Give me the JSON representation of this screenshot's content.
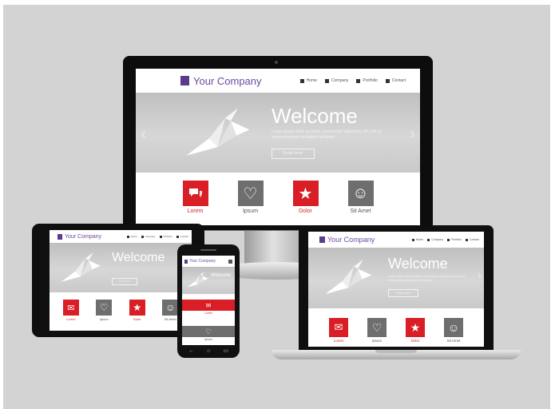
{
  "site": {
    "brand": "Your Company",
    "nav": [
      "Home",
      "Company",
      "Portfolio",
      "Contact"
    ],
    "hero": {
      "title": "Welcome",
      "tagline": "Lorem ipsum dolor sit amet, consectetur adipiscing elit, sed do eiusmod tempor incididunt ut labore",
      "cta": "Read more"
    },
    "features": [
      {
        "label": "Lorem",
        "icon": "chat-icon",
        "color": "#d91e25"
      },
      {
        "label": "Ipsum",
        "icon": "heart-icon",
        "color": "#6e6e6e"
      },
      {
        "label": "Dolor",
        "icon": "star-icon",
        "color": "#d91e25"
      },
      {
        "label": "Sit Amet",
        "icon": "smiley-icon",
        "color": "#6e6e6e"
      }
    ]
  },
  "colors": {
    "accent": "#d91e25",
    "brand": "#5b3b8c",
    "neutral": "#6e6e6e",
    "background": "#d3d3d3"
  }
}
